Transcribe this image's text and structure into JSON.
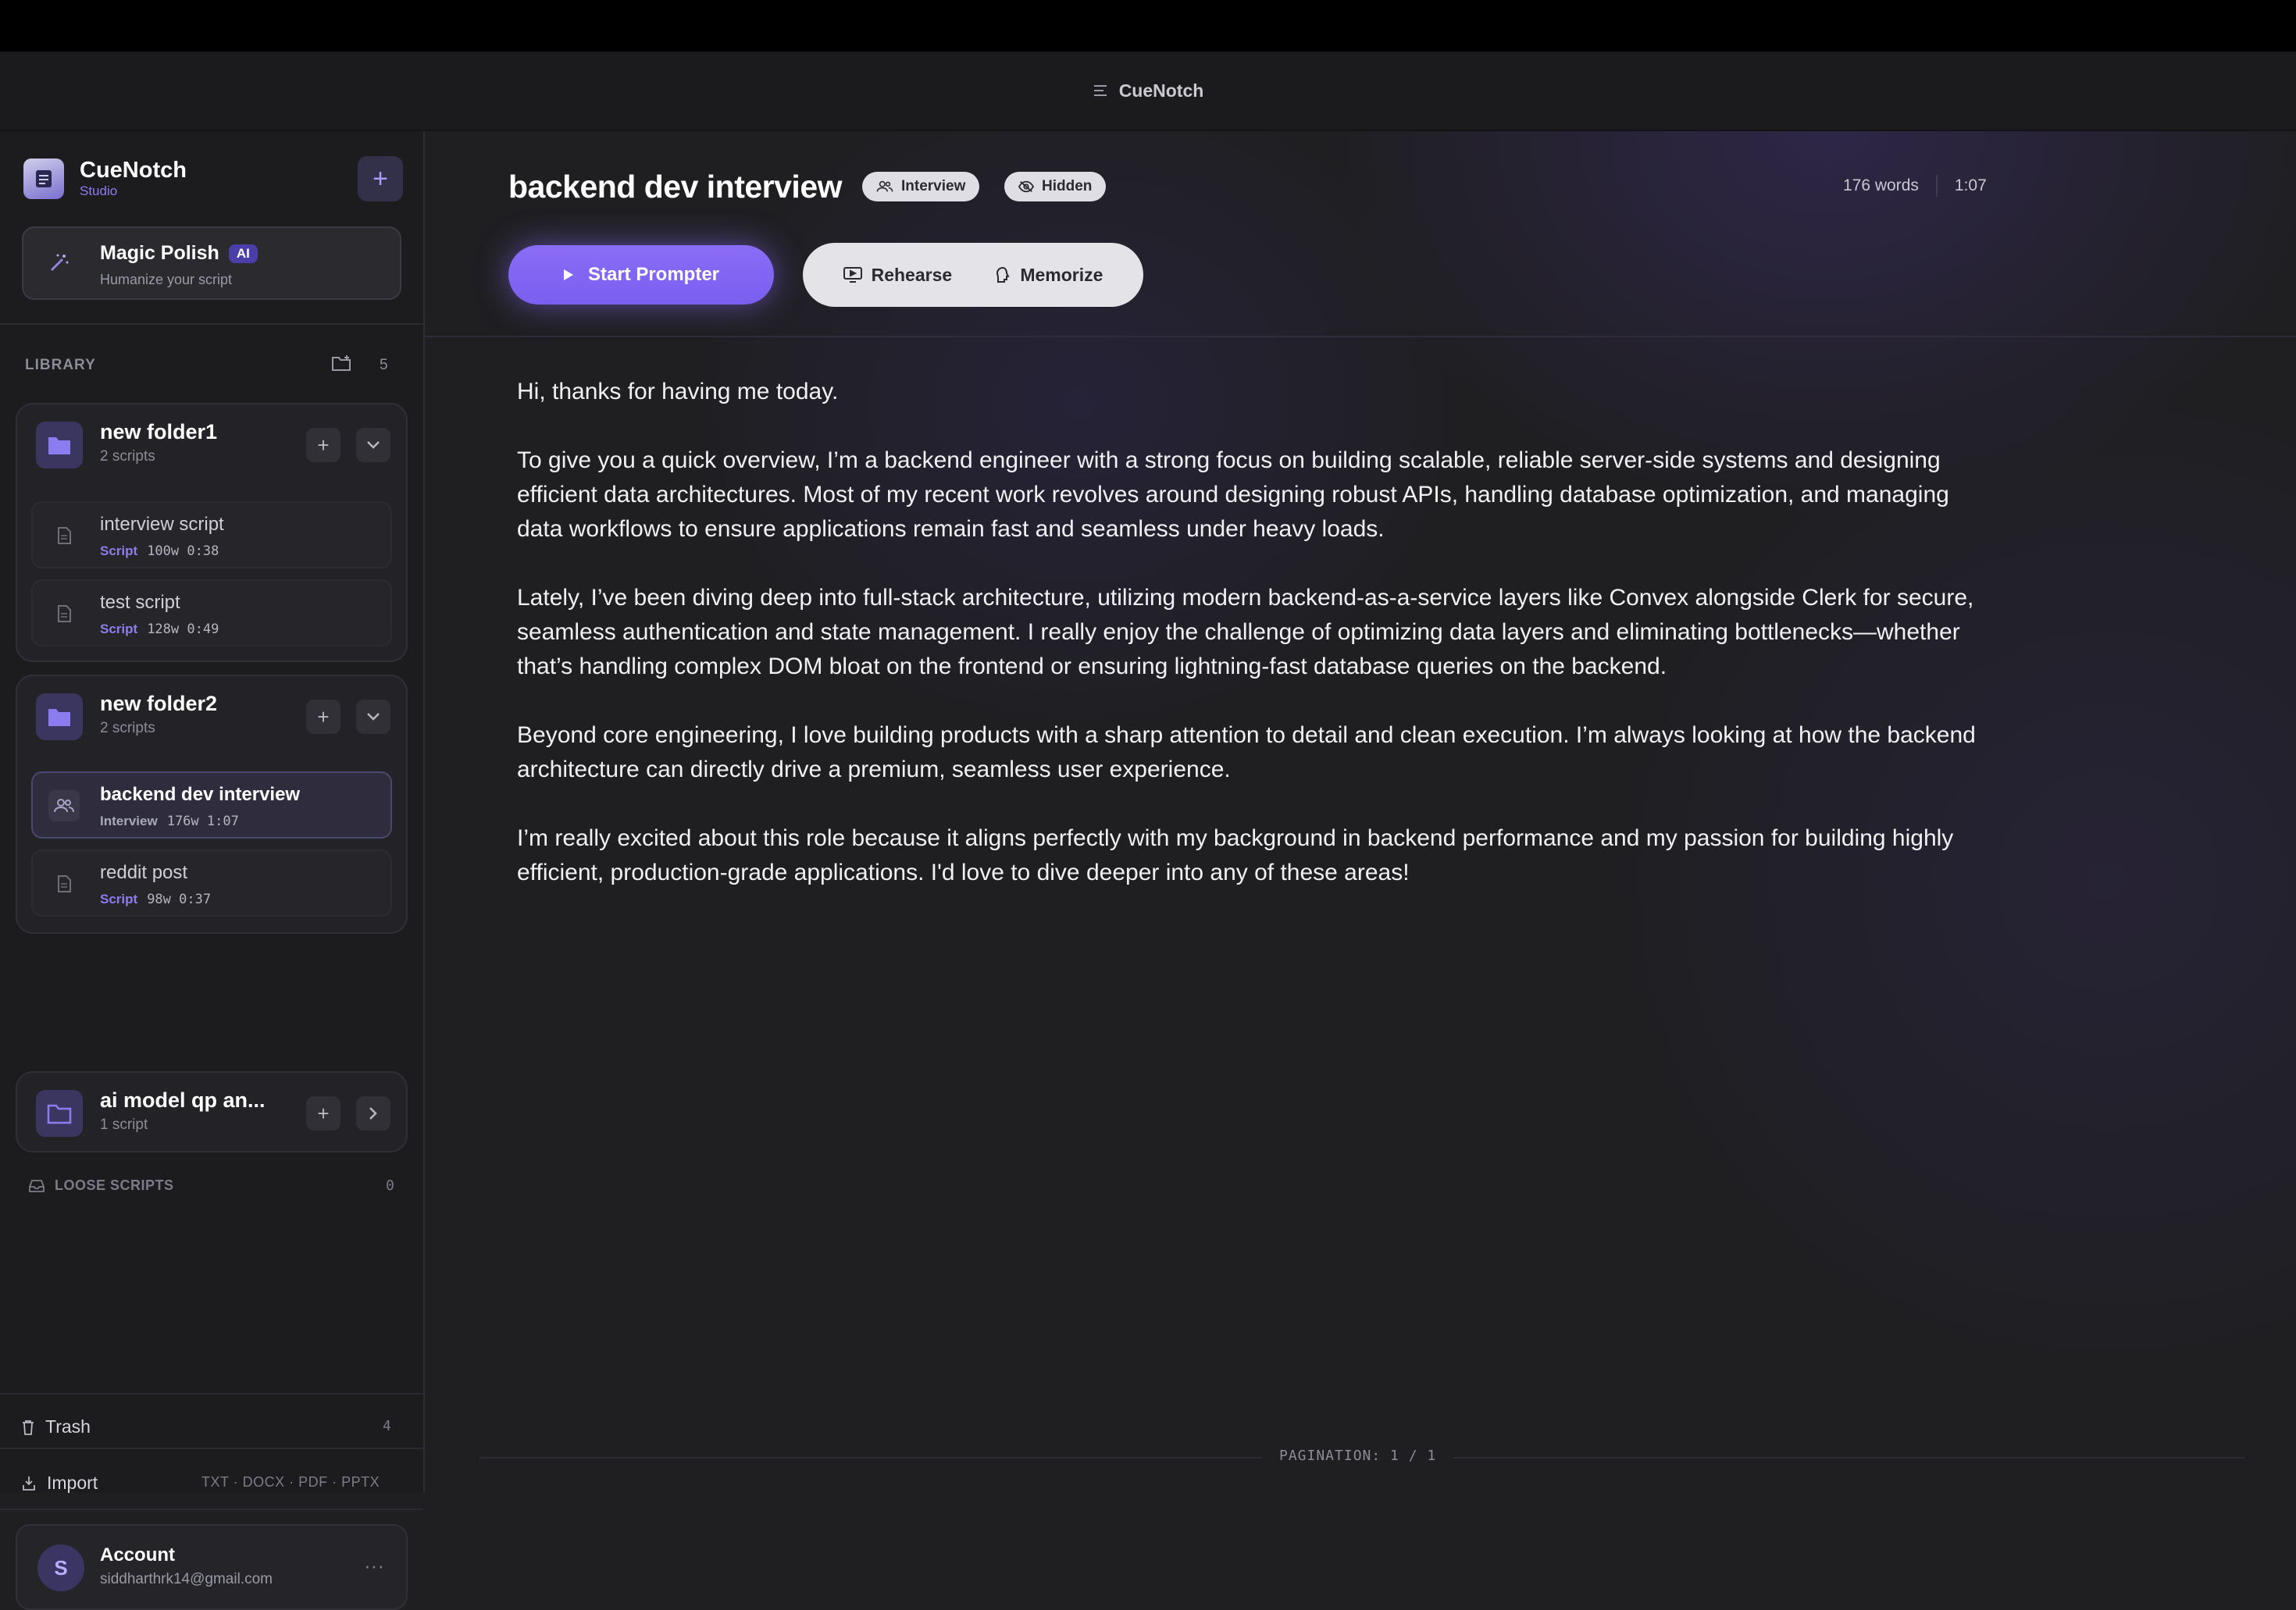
{
  "window": {
    "title": "CueNotch"
  },
  "sidebar": {
    "brand_name": "CueNotch",
    "brand_sub": "Studio",
    "magic_polish": {
      "title": "Magic Polish",
      "badge": "AI",
      "subtitle": "Humanize your script"
    },
    "library": {
      "label": "LIBRARY",
      "count": "5"
    },
    "folders": [
      {
        "name": "new folder1",
        "count": "2 scripts",
        "scripts": [
          {
            "name": "interview script",
            "type": "Script",
            "words": "100w",
            "time": "0:38"
          },
          {
            "name": "test script",
            "type": "Script",
            "words": "128w",
            "time": "0:49"
          }
        ]
      },
      {
        "name": "new folder2",
        "count": "2 scripts",
        "scripts": [
          {
            "name": "backend dev interview",
            "type": "Interview",
            "words": "176w",
            "time": "1:07"
          },
          {
            "name": "reddit post",
            "type": "Script",
            "words": "98w",
            "time": "0:37"
          }
        ]
      },
      {
        "name": "ai model qp an...",
        "count": "1 script",
        "scripts": []
      }
    ],
    "loose_scripts": {
      "label": "LOOSE SCRIPTS",
      "count": "0"
    },
    "trash": {
      "label": "Trash",
      "count": "4"
    },
    "import": {
      "label": "Import",
      "formats": "TXT · DOCX · PDF · PPTX"
    },
    "account": {
      "initial": "S",
      "name": "Account",
      "email": "siddharthrk14@gmail.com"
    }
  },
  "main": {
    "title": "backend dev interview",
    "tags": [
      "Interview",
      "Hidden"
    ],
    "words": "176 words",
    "duration": "1:07",
    "start_button": "Start Prompter",
    "modes": [
      "Rehearse",
      "Memorize"
    ],
    "paragraphs": [
      "Hi, thanks for having me today.",
      "To give you a quick overview, I’m a backend engineer with a strong focus on building scalable, reliable server-side systems and designing efficient data architectures. Most of my recent work revolves around designing robust APIs, handling database optimization, and managing data workflows to ensure applications remain fast and seamless under heavy loads.",
      "Lately, I’ve been diving deep into full-stack architecture, utilizing modern backend-as-a-service layers like Convex alongside Clerk for secure, seamless authentication and state management. I really enjoy the challenge of optimizing data layers and eliminating bottlenecks—whether that’s handling complex DOM bloat on the frontend or ensuring lightning-fast database queries on the backend.",
      "Beyond core engineering, I love building products with a sharp attention to detail and clean execution. I’m always looking at how the backend architecture can directly drive a premium, seamless user experience.",
      "I’m really excited about this role because it aligns perfectly with my background in backend performance and my passion for building highly efficient, production-grade applications. I'd love to dive deeper into any of these areas!"
    ],
    "pagination": "PAGINATION: 1 / 1"
  },
  "colors": {
    "accent": "#8a6df6",
    "background": "#1f1f22",
    "sidebar": "#1c1c1f"
  },
  "icons": [
    "list-icon",
    "app-logo-icon",
    "plus-icon",
    "magic-wand-icon",
    "folder-plus-icon",
    "folder-icon",
    "chevron-down-icon",
    "chevron-right-icon",
    "document-icon",
    "people-icon",
    "inbox-icon",
    "trash-icon",
    "import-icon",
    "more-icon",
    "eye-off-icon",
    "play-icon",
    "monitor-icon",
    "brain-icon"
  ]
}
